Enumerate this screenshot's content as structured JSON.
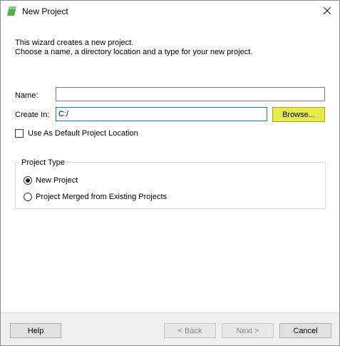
{
  "window": {
    "title": "New Project"
  },
  "description": {
    "line1": "This wizard creates a new project.",
    "line2": "Choose a name, a directory location and a type for your new project."
  },
  "form": {
    "name_label": "Name:",
    "name_value": "",
    "create_in_label": "Create In:",
    "create_in_value": "C:/",
    "browse_label": "Browse...",
    "default_location_label": "Use As Default Project Location",
    "default_location_checked": false
  },
  "project_type": {
    "title": "Project Type",
    "options": [
      {
        "label": "New Project",
        "selected": true
      },
      {
        "label": "Project Merged from Existing Projects",
        "selected": false
      }
    ]
  },
  "buttons": {
    "help": "Help",
    "back": "< Back",
    "next": "Next >",
    "cancel": "Cancel"
  },
  "colors": {
    "browse_highlight": "#e7eb4c",
    "app_icon": "#4caf50"
  },
  "icons": {
    "app": "app-icon",
    "close": "close-icon"
  }
}
